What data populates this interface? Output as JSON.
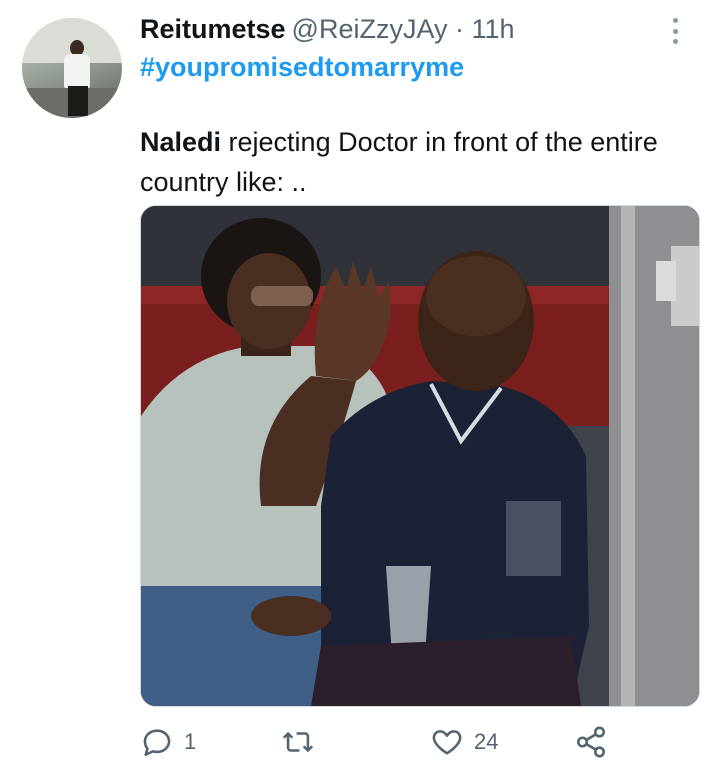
{
  "tweet": {
    "display_name": "Reitumetse",
    "meta": "@ReiZzyJAy · 11h",
    "hashtag": "#youpromisedtomarryme",
    "text_bold": "Naledi",
    "text_rest": " rejecting Doctor in front of the entire country like: .."
  },
  "actions": {
    "reply_count": "1",
    "retweet_count": "",
    "like_count": "24"
  },
  "colors": {
    "link": "#1d9bf0",
    "text": "#0f1419",
    "muted": "#536471"
  },
  "icons": [
    "more-vertical-icon",
    "reply-icon",
    "retweet-icon",
    "like-icon",
    "share-icon"
  ]
}
